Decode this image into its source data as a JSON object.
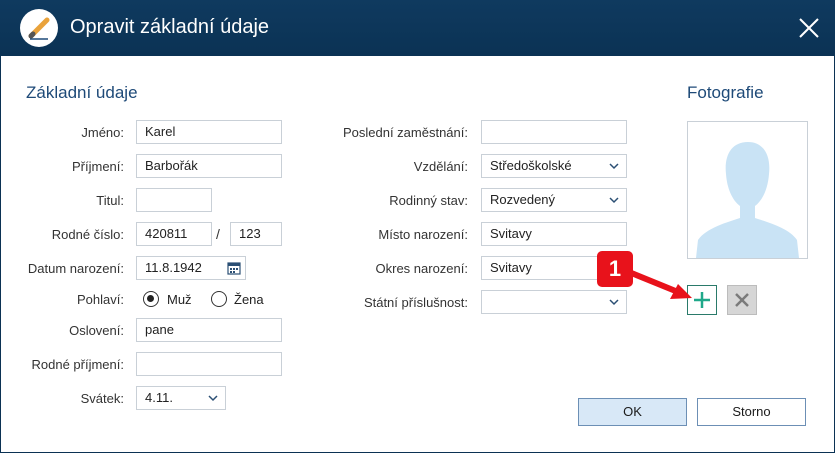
{
  "window": {
    "title": "Opravit základní údaje",
    "icons": {
      "app": "pencil-icon",
      "close": "close-icon"
    }
  },
  "basic": {
    "heading": "Základní údaje",
    "first_name": {
      "label": "Jméno:",
      "value": "Karel"
    },
    "last_name": {
      "label": "Příjmení:",
      "value": "Barbořák"
    },
    "title": {
      "label": "Titul:",
      "value": ""
    },
    "birth_number": {
      "label": "Rodné číslo:",
      "value1": "420811",
      "separator": "/",
      "value2": "123"
    },
    "birth_date": {
      "label": "Datum narození:",
      "value": "11.8.1942",
      "icon": "calendar-icon"
    },
    "gender": {
      "label": "Pohlaví:",
      "options": [
        "Muž",
        "Žena"
      ],
      "selected": "Muž"
    },
    "salutation": {
      "label": "Oslovení:",
      "value": "pane"
    },
    "maiden_name": {
      "label": "Rodné příjmení:",
      "value": ""
    },
    "name_day": {
      "label": "Svátek:",
      "value": "4.11."
    }
  },
  "other": {
    "last_employment": {
      "label": "Poslední zaměstnání:",
      "value": ""
    },
    "education": {
      "label": "Vzdělání:",
      "value": "Středoškolské"
    },
    "marital_status": {
      "label": "Rodinný stav:",
      "value": "Rozvedený"
    },
    "birth_place": {
      "label": "Místo narození:",
      "value": "Svitavy"
    },
    "birth_district": {
      "label": "Okres narození:",
      "value": "Svitavy"
    },
    "citizenship": {
      "label": "Státní příslušnost:",
      "value": ""
    }
  },
  "photo": {
    "heading": "Fotografie",
    "placeholder_icon": "person-silhouette-icon",
    "add_icon": "plus-icon",
    "remove_icon": "x-icon"
  },
  "annotation": {
    "number": "1",
    "color": "#e8121b"
  },
  "buttons": {
    "ok": "OK",
    "cancel": "Storno"
  },
  "colors": {
    "titlebar": "#0b3254",
    "heading": "#1e4a78",
    "ok_bg": "#d8e8f7",
    "add_accent": "#1fa88a"
  }
}
